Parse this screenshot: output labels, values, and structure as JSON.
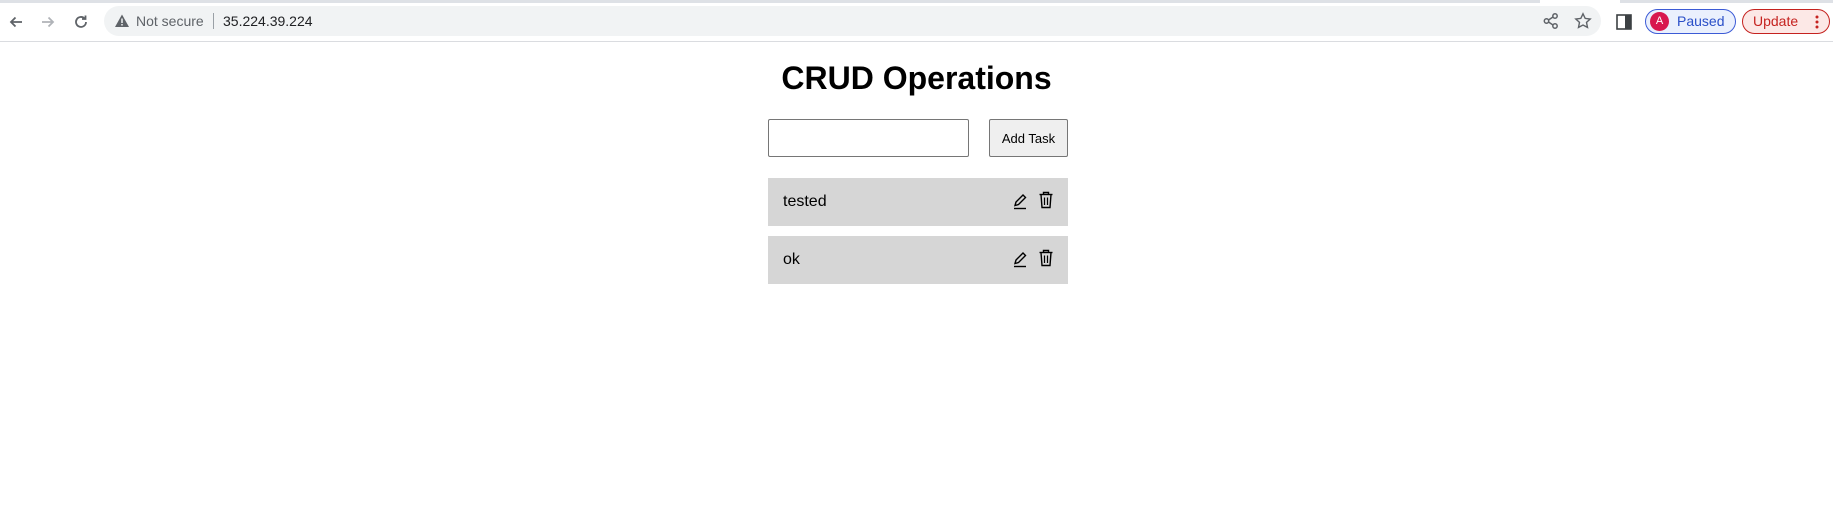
{
  "browser": {
    "security_label": "Not secure",
    "url": "35.224.39.224",
    "profile_initial": "A",
    "profile_status": "Paused",
    "update_label": "Update",
    "icons": {
      "back": "back-arrow-icon",
      "forward": "forward-arrow-icon",
      "reload": "reload-icon",
      "warning": "warning-icon",
      "share": "share-icon",
      "bookmark": "star-icon",
      "side_panel": "side-panel-icon",
      "menu": "kebab-menu-icon"
    },
    "colors": {
      "profile_accent": "#2a4fc8",
      "avatar_bg": "#d8174e",
      "update_accent": "#c5221f"
    }
  },
  "app": {
    "title": "CRUD Operations",
    "input_value": "",
    "add_button_label": "Add Task",
    "tasks": [
      {
        "text": "tested"
      },
      {
        "text": "ok"
      }
    ],
    "task_item_bg": "#d6d6d6"
  }
}
